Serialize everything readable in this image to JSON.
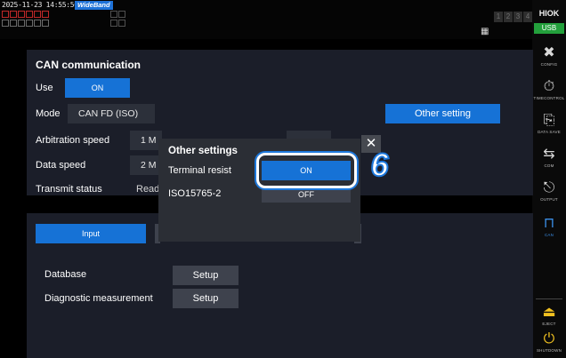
{
  "status_bar": {
    "timestamp": "2025-11-23 14:55:50",
    "wideband": "WideBand",
    "tab_numbers": [
      "1",
      "2",
      "3",
      "4"
    ]
  },
  "sidebar": {
    "brand": "HIOK",
    "usb": "USB",
    "buttons": [
      {
        "label": "CONFIG",
        "icon": "wrench-screwdriver-icon"
      },
      {
        "label": "TIMECONTROL",
        "icon": "stopwatch-icon"
      },
      {
        "label": "DATA SAVE",
        "icon": "data-save-icon"
      },
      {
        "label": "COM",
        "icon": "arrows-icon"
      },
      {
        "label": "OUTPUT",
        "icon": "output-icon"
      },
      {
        "label": "CAN",
        "icon": "can-waveform-icon"
      },
      {
        "label": "EJECT",
        "icon": "eject-icon"
      },
      {
        "label": "SHUTDOWN",
        "icon": "shutdown-icon"
      }
    ]
  },
  "can_panel": {
    "title": "CAN communication",
    "use_label": "Use",
    "use_value": "ON",
    "mode_label": "Mode",
    "mode_value": "CAN FD (ISO)",
    "other_setting": "Other setting",
    "arbitration_label": "Arbitration speed",
    "arbitration_value": "1 M",
    "data_speed_label": "Data speed",
    "data_speed_value": "2 M",
    "transmit_label": "Transmit status",
    "transmit_value": "Read"
  },
  "lower_panel": {
    "input_tab": "Input",
    "database_label": "Database",
    "database_button": "Setup",
    "diagnostic_label": "Diagnostic measurement",
    "diagnostic_button": "Setup"
  },
  "dialog": {
    "title": "Other settings",
    "terminal_label": "Terminal resist",
    "terminal_value": "ON",
    "iso_label": "ISO15765-2",
    "iso_value": "OFF",
    "close": "✕"
  },
  "callout": "6",
  "colors": {
    "accent": "#1672d6",
    "panel": "#1b1e29",
    "dialog": "#2b2e35",
    "usb": "#23a03c"
  }
}
